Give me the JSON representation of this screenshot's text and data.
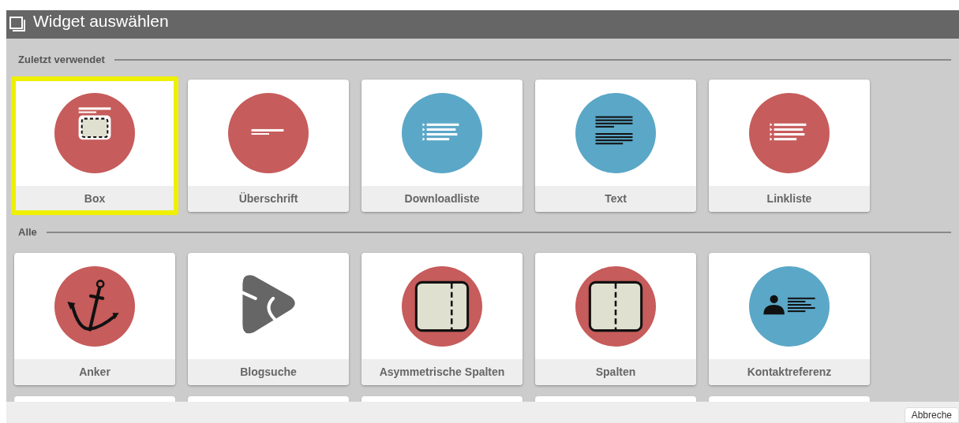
{
  "dialog": {
    "title": "Widget auswählen"
  },
  "sections": [
    {
      "label": "Zuletzt verwendet",
      "widgets": [
        {
          "label": "Box",
          "kind": "box",
          "color": "#c65c5b",
          "highlighted": true
        },
        {
          "label": "Überschrift",
          "kind": "heading",
          "color": "#c65c5b",
          "highlighted": false
        },
        {
          "label": "Downloadliste",
          "kind": "downloadlist",
          "color": "#5ba7c7",
          "highlighted": false
        },
        {
          "label": "Text",
          "kind": "text",
          "color": "#5ba7c7",
          "highlighted": false
        },
        {
          "label": "Linkliste",
          "kind": "linklist",
          "color": "#c65c5b",
          "highlighted": false
        }
      ]
    },
    {
      "label": "Alle",
      "widgets": [
        {
          "label": "Anker",
          "kind": "anchor",
          "color": "#c65c5b",
          "highlighted": false
        },
        {
          "label": "Blogsuche",
          "kind": "blogsearch",
          "highlighted": false
        },
        {
          "label": "Asymmetrische Spalten",
          "kind": "asymcolumns",
          "color": "#c65c5b",
          "highlighted": false
        },
        {
          "label": "Spalten",
          "kind": "columns",
          "color": "#c65c5b",
          "highlighted": false
        },
        {
          "label": "Kontaktreferenz",
          "kind": "contact",
          "color": "#5ba7c7",
          "highlighted": false
        }
      ]
    }
  ],
  "footer": {
    "cancel_button": "Abbreche"
  }
}
